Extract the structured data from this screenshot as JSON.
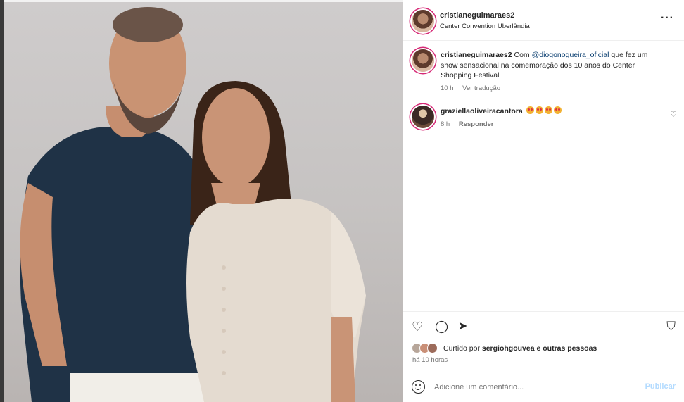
{
  "header": {
    "username": "cristianeguimaraes2",
    "location": "Center Convention Uberlândia",
    "more_icon": "more-horizontal-icon",
    "more_glyph": "···"
  },
  "caption": {
    "username": "cristianeguimaraes2",
    "text_before": "Com",
    "mention": "@diogonogueira_oficial",
    "text_after": "que fez um show sensacional na comemoração dos 10 anos do Center Shopping Festival",
    "time": "10 h",
    "translate": "Ver tradução"
  },
  "comment": {
    "username": "graziellaoliveiracantora",
    "emoji_icon": "heart-eyes-emoji-icon",
    "emoji_count": 4,
    "time": "8 h",
    "reply": "Responder",
    "like_glyph": "♡"
  },
  "actions": {
    "like_glyph": "♡",
    "comment_glyph": "◯",
    "share_glyph": "➤",
    "save_glyph": "⛉"
  },
  "likes": {
    "prefix": "Curtido por",
    "user": "sergiohgouvea",
    "suffix": "e outras pessoas"
  },
  "post_time": "há 10 horas",
  "add_comment": {
    "placeholder": "Adicione um comentário...",
    "post_label": "Publicar"
  },
  "colors": {
    "mention": "#00376b",
    "muted": "#737373",
    "post_disabled": "#b3dbff",
    "story_ring": "#d62976"
  }
}
